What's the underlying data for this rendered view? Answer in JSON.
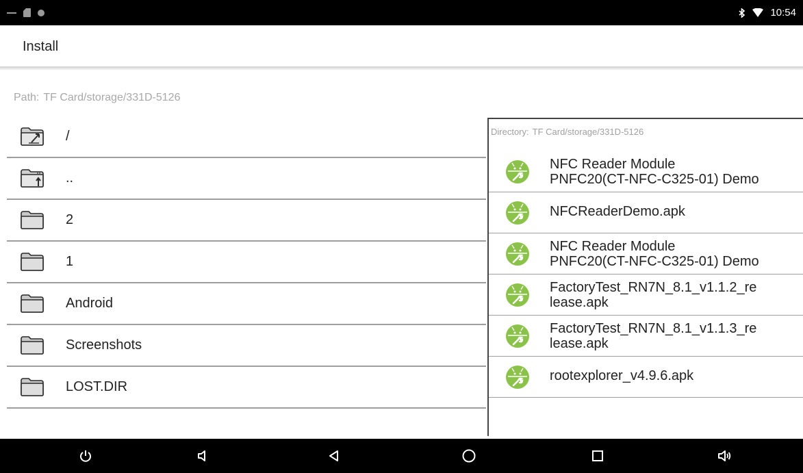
{
  "status_bar": {
    "time": "10:54",
    "left_icons": [
      "minus-icon",
      "sd-card-icon",
      "record-icon"
    ],
    "right_icons": [
      "bluetooth-icon",
      "wifi-icon"
    ]
  },
  "action_bar": {
    "title": "Install"
  },
  "path": {
    "label": "Path:",
    "value": "TF Card/storage/331D-5126"
  },
  "files": [
    {
      "name": "/",
      "icon": "folder-root-icon"
    },
    {
      "name": "..",
      "icon": "folder-up-icon"
    },
    {
      "name": "2",
      "icon": "folder-icon"
    },
    {
      "name": "1",
      "icon": "folder-icon"
    },
    {
      "name": "Android",
      "icon": "folder-icon"
    },
    {
      "name": "Screenshots",
      "icon": "folder-icon"
    },
    {
      "name": "LOST.DIR",
      "icon": "folder-icon"
    }
  ],
  "dialog": {
    "label": "Directory:",
    "value": "TF Card/storage/331D-5126",
    "apks": [
      {
        "name": "NFC Reader Module\nPNFC20(CT-NFC-C325-01) Demo"
      },
      {
        "name": "NFCReaderDemo.apk"
      },
      {
        "name": "NFC Reader Module\nPNFC20(CT-NFC-C325-01) Demo"
      },
      {
        "name": "FactoryTest_RN7N_8.1_v1.1.2_re\nlease.apk"
      },
      {
        "name": "FactoryTest_RN7N_8.1_v1.1.3_re\nlease.apk"
      },
      {
        "name": "rootexplorer_v4.9.6.apk"
      }
    ]
  },
  "nav_bar": {
    "buttons": [
      "power-icon",
      "volume-down-icon",
      "back-icon",
      "home-icon",
      "recents-icon",
      "volume-up-icon"
    ]
  },
  "colors": {
    "android_green": "#8bc34a",
    "folder_gray": "#c8c8c8",
    "divider": "#9e9e9e",
    "muted_text": "#a8a8a8"
  }
}
